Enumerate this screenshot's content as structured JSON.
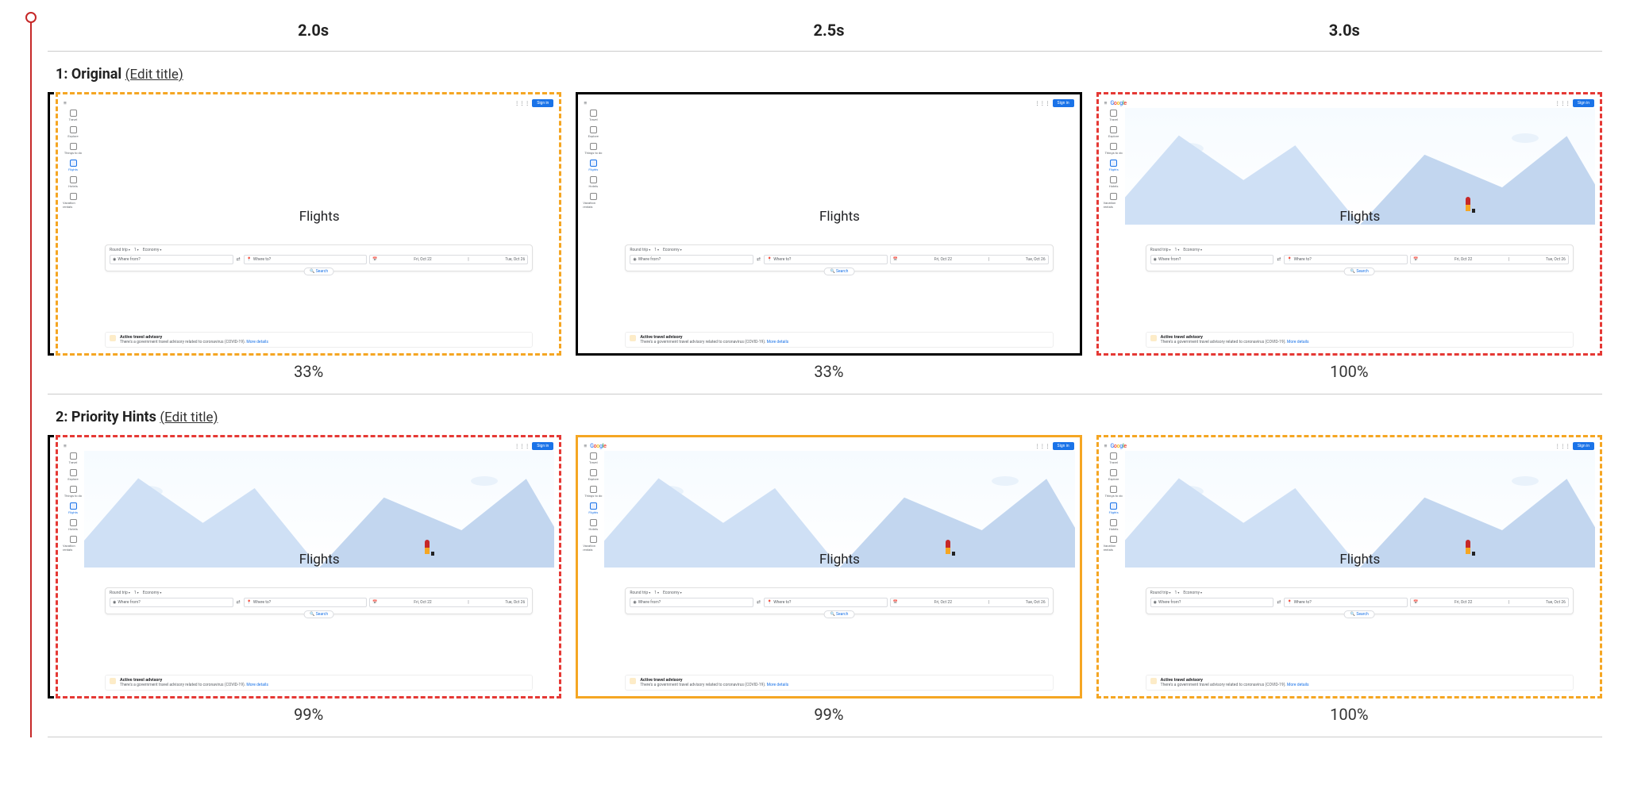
{
  "time_labels": [
    "2.0s",
    "2.5s",
    "3.0s"
  ],
  "rows": [
    {
      "index": "1",
      "name": "Original",
      "edit": "(Edit title)",
      "frames": [
        {
          "pct": "33%",
          "border": "dashed-orange",
          "bracket": true,
          "hero": "blank",
          "logo": false
        },
        {
          "pct": "33%",
          "border": "solid-black",
          "bracket": false,
          "hero": "blank",
          "logo": false
        },
        {
          "pct": "100%",
          "border": "dashed-red",
          "bracket": false,
          "hero": "loaded",
          "logo": true
        }
      ]
    },
    {
      "index": "2",
      "name": "Priority Hints",
      "edit": "(Edit title)",
      "frames": [
        {
          "pct": "99%",
          "border": "dashed-red",
          "bracket": true,
          "hero": "loaded",
          "logo": false
        },
        {
          "pct": "99%",
          "border": "solid-orange",
          "bracket": false,
          "hero": "loaded",
          "logo": true
        },
        {
          "pct": "100%",
          "border": "dashed-orange",
          "bracket": false,
          "hero": "loaded",
          "logo": true
        }
      ]
    }
  ],
  "shot": {
    "flights_heading": "Flights",
    "signin": "Sign in",
    "sidebar": [
      "Travel",
      "Explore",
      "Things to do",
      "Flights",
      "Hotels",
      "Vacation rentals"
    ],
    "active_side_index": 3,
    "chips": {
      "trip": "Round trip",
      "pax": "1",
      "class": "Economy"
    },
    "fields": {
      "from": "Where from?",
      "to": "Where to?",
      "date_out": "Fri, Oct 22",
      "date_ret": "Tue, Oct 26"
    },
    "search_label": "Search",
    "advisory": {
      "title": "Active travel advisory",
      "body": "There's a government travel advisory related to coronavirus (COVID-19).",
      "more": "More details"
    },
    "icons": {
      "swap": "⇄",
      "origin": "◉",
      "dest": "📍",
      "cal": "📅",
      "menu": "≡",
      "grid": "⋮⋮⋮"
    }
  }
}
